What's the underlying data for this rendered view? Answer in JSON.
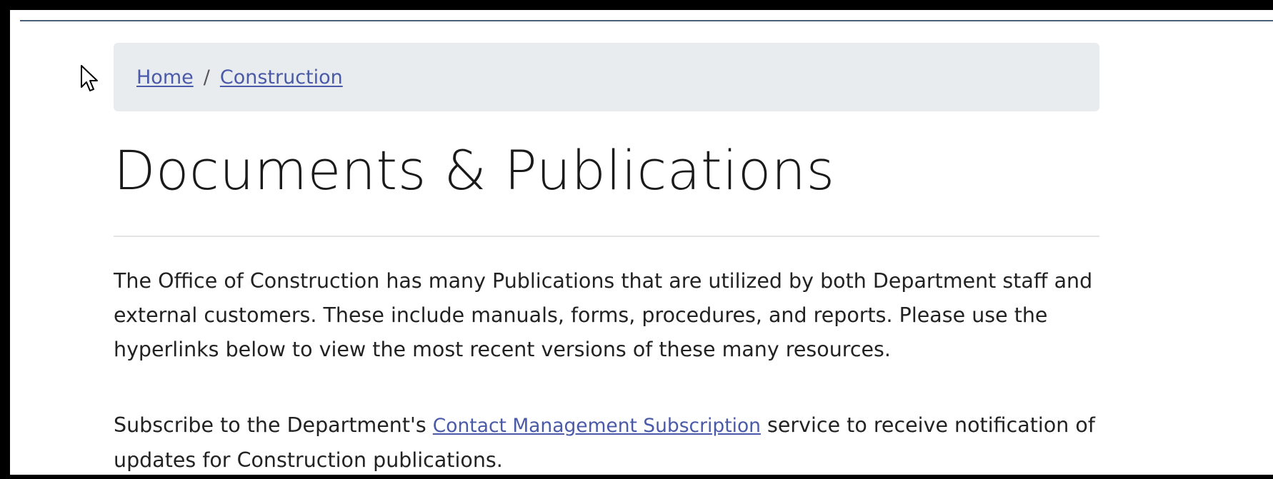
{
  "breadcrumb": {
    "home": "Home",
    "separator": "/",
    "current": "Construction"
  },
  "page": {
    "title": "Documents & Publications",
    "intro": "The Office of Construction has many Publications that are utilized by both Department staff and external customers. These include manuals, forms, procedures, and reports. Please use the hyperlinks below to view the most recent versions of these many resources.",
    "subscribe_before": "Subscribe to the Department's ",
    "subscribe_link": "Contact Management Subscription",
    "subscribe_after": " service to receive notification of updates for Construction publications."
  },
  "colors": {
    "breadcrumb_bg": "#e9ecef",
    "link": "#4a5aa8",
    "text": "#222222",
    "frame": "#000000"
  },
  "icons": {
    "cursor": "mouse-pointer-icon"
  }
}
